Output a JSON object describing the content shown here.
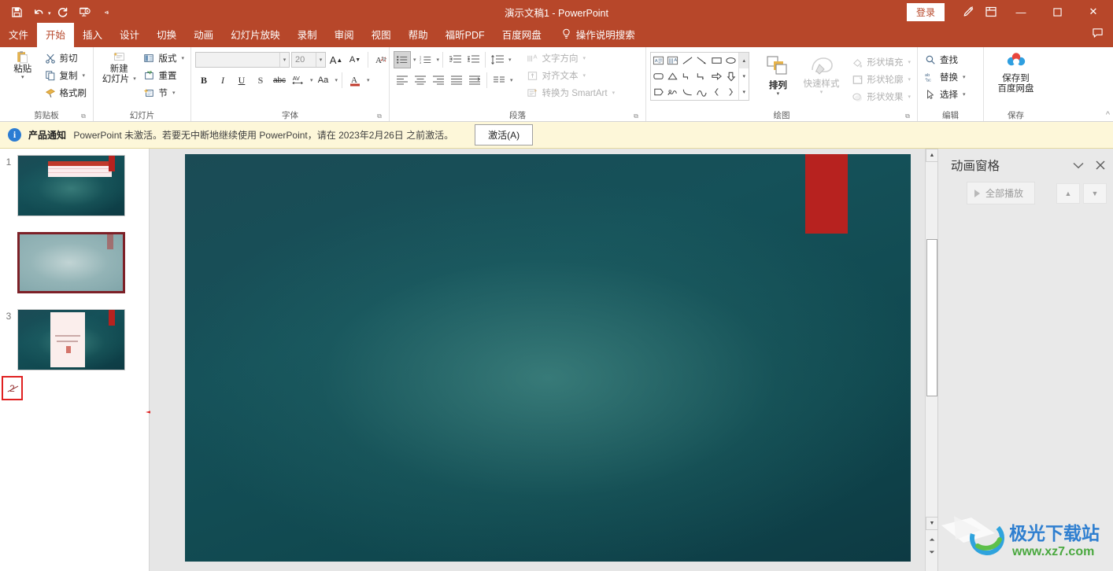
{
  "titlebar": {
    "quick_access": [
      {
        "name": "save-icon",
        "label": "保存"
      },
      {
        "name": "undo-icon",
        "label": "撤消"
      },
      {
        "name": "redo-icon",
        "label": "重复"
      },
      {
        "name": "start-slideshow-icon",
        "label": "从头开始"
      },
      {
        "name": "customize-qat-icon",
        "label": "自定义快速访问工具栏"
      }
    ],
    "title": "演示文稿1 - PowerPoint",
    "signin_label": "登录",
    "ribbon_display_icon": "ribbon-display-options-icon",
    "pen_icon": "ink-pen-icon",
    "minimize": "—",
    "maximize": "☐",
    "close": "✕"
  },
  "tabs": [
    {
      "label": "文件",
      "active": false
    },
    {
      "label": "开始",
      "active": true
    },
    {
      "label": "插入",
      "active": false
    },
    {
      "label": "设计",
      "active": false
    },
    {
      "label": "切换",
      "active": false
    },
    {
      "label": "动画",
      "active": false
    },
    {
      "label": "幻灯片放映",
      "active": false
    },
    {
      "label": "录制",
      "active": false
    },
    {
      "label": "审阅",
      "active": false
    },
    {
      "label": "视图",
      "active": false
    },
    {
      "label": "帮助",
      "active": false
    },
    {
      "label": "福昕PDF",
      "active": false
    },
    {
      "label": "百度网盘",
      "active": false
    }
  ],
  "tell_me": "操作说明搜索",
  "ribbon": {
    "clipboard": {
      "group_label": "剪贴板",
      "paste": "粘贴",
      "cut": "剪切",
      "copy": "复制",
      "format_painter": "格式刷"
    },
    "slides": {
      "group_label": "幻灯片",
      "new_slide_line1": "新建",
      "new_slide_line2": "幻灯片",
      "layout": "版式",
      "reset": "重置",
      "section": "节"
    },
    "font": {
      "group_label": "字体",
      "font_name": "",
      "font_name_placeholder": "",
      "font_size": "20",
      "bold": "B",
      "italic": "I",
      "underline": "U",
      "shadow": "S",
      "strikethrough": "abc",
      "char_spacing": "AV",
      "change_case": "Aa",
      "font_color": "A",
      "grow_font": "A",
      "shrink_font": "A",
      "clear_formatting": "clear-formatting-icon"
    },
    "paragraph": {
      "group_label": "段落",
      "text_direction": "文字方向",
      "align_text": "对齐文本",
      "convert_smartart": "转换为 SmartArt"
    },
    "drawing": {
      "group_label": "绘图",
      "arrange": "排列",
      "quick_styles": "快速样式",
      "shape_fill": "形状填充",
      "shape_outline": "形状轮廓",
      "shape_effects": "形状效果"
    },
    "editing": {
      "group_label": "编辑",
      "find": "查找",
      "replace": "替换",
      "select": "选择"
    },
    "save_group": {
      "group_label": "保存",
      "baidu_line1": "保存到",
      "baidu_line2": "百度网盘"
    }
  },
  "notice": {
    "icon": "info-icon",
    "bold_prefix": "产品通知",
    "message": "PowerPoint 未激活。若要无中断地继续使用 PowerPoint，请在 2023年2月26日 之前激活。",
    "activate_label": "激活(A)"
  },
  "thumbnails": {
    "slides": [
      {
        "number": "1",
        "selected": false,
        "hidden": false
      },
      {
        "number": "2",
        "selected": true,
        "hidden": true
      },
      {
        "number": "3",
        "selected": false,
        "hidden": false
      }
    ],
    "hidden_marker_number": "2"
  },
  "animation_pane": {
    "title": "动画窗格",
    "collapse_icon": "chevron-down-icon",
    "close_icon": "close-icon",
    "play_all_label": "全部播放",
    "move_up_icon": "arrow-up-icon",
    "move_down_icon": "arrow-down-icon"
  },
  "watermark": {
    "brand": "极光下载站",
    "url": "www.xz7.com"
  },
  "colors": {
    "accent": "#b7472a",
    "notice_bg": "#fdf7d9",
    "selection_border": "#7d2027",
    "annotation_red": "#e02020",
    "slide_teal": "#10484f",
    "slide_red_tab": "#b7221f"
  }
}
